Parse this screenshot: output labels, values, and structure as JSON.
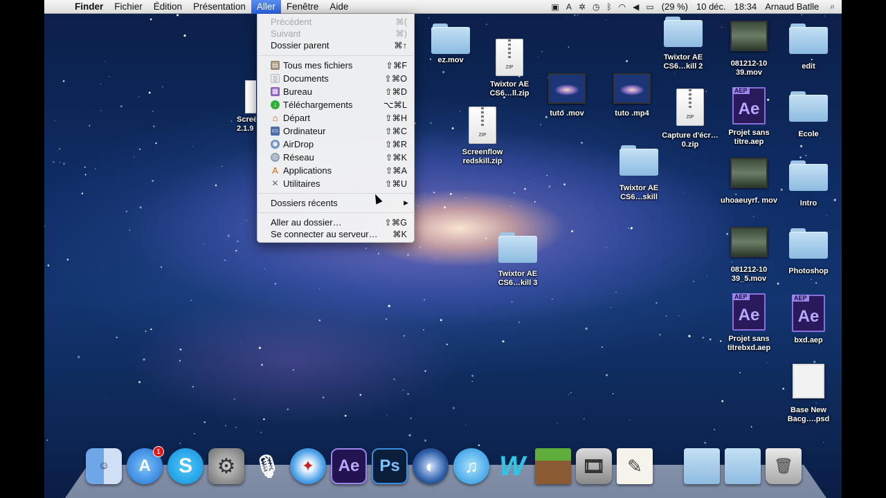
{
  "menubar": {
    "app": "Finder",
    "menus": [
      "Fichier",
      "Édition",
      "Présentation",
      "Aller",
      "Fenêtre",
      "Aide"
    ],
    "status": {
      "battery": "(29 %)",
      "date": "10 déc.",
      "time": "18:34",
      "user": "Arnaud Batlle"
    }
  },
  "aller_menu": {
    "top": [
      {
        "label": "Précédent",
        "shortcut": "⌘("
      },
      {
        "label": "Suivant",
        "shortcut": "⌘)"
      },
      {
        "label": "Dossier parent",
        "shortcut": "⌘↑"
      }
    ],
    "places": [
      {
        "label": "Tous mes fichiers",
        "shortcut": "⇧⌘F"
      },
      {
        "label": "Documents",
        "shortcut": "⇧⌘O"
      },
      {
        "label": "Bureau",
        "shortcut": "⇧⌘D"
      },
      {
        "label": "Téléchargements",
        "shortcut": "⌥⌘L"
      },
      {
        "label": "Départ",
        "shortcut": "⇧⌘H"
      },
      {
        "label": "Ordinateur",
        "shortcut": "⇧⌘C"
      },
      {
        "label": "AirDrop",
        "shortcut": "⇧⌘R"
      },
      {
        "label": "Réseau",
        "shortcut": "⇧⌘K"
      },
      {
        "label": "Applications",
        "shortcut": "⇧⌘A"
      },
      {
        "label": "Utilitaires",
        "shortcut": "⇧⌘U"
      }
    ],
    "recent": {
      "label": "Dossiers récents"
    },
    "bottom": [
      {
        "label": "Aller au dossier…",
        "shortcut": "⇧⌘G"
      },
      {
        "label": "Se connecter au serveur…",
        "shortcut": "⌘K"
      }
    ]
  },
  "desktop": {
    "ezmov": "ez.mov",
    "twixtor_zip": "Twixtor AE CS6…ll.zip",
    "tuto_mov": "tuto .mov",
    "tuto_mp4": "tuto .mp4",
    "twixtor_2": "Twixtor AE CS6…kill 2",
    "capture_zip": "Capture d'écr…0.zip",
    "screenflow_zip": "Screenflow redskill.zip",
    "twixtor_skill": "Twixtor AE CS6…skill",
    "twixtor_3": "Twixtor AE CS6…kill 3",
    "screen_partial": "Scree 2.1.9",
    "mov_081212_1039": "081212-10 39.mov",
    "projet_sans_titre": "Projet sans titre.aep",
    "uhoaeuyrf": "uhoaeuyrf. mov",
    "mov_081212_1039_5": "081212-10 39_5.mov",
    "projet_sans_titrebxd": "Projet sans titrebxd.aep",
    "edit": "edit",
    "ecole": "Ecole",
    "intro": "Intro",
    "photoshop": "Photoshop",
    "bxd": "bxd.aep",
    "base_new": "Base New Bacg….psd"
  },
  "dock": {
    "appstore_badge": "1",
    "ae": "Ae",
    "ps": "Ps"
  },
  "icons": {
    "aep_tag": "AEP",
    "aep_big": "Ae",
    "zip_tag": "ZIP"
  }
}
